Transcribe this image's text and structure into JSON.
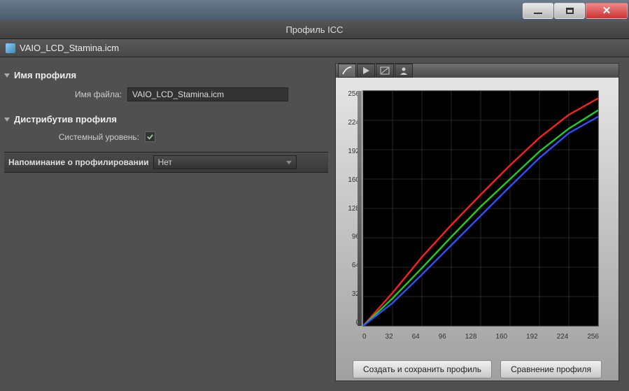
{
  "window": {
    "title": "Профиль ICC",
    "filename": "VAIO_LCD_Stamina.icm"
  },
  "sections": {
    "profile_name": {
      "title": "Имя профиля",
      "filename_label": "Имя файла:",
      "filename_value": "VAIO_LCD_Stamina.icm"
    },
    "distribution": {
      "title": "Дистрибутив профиля",
      "system_level_label": "Системный уровень:",
      "system_level_checked": true
    },
    "reminder": {
      "label": "Напоминание о профилировании",
      "value": "Нет"
    }
  },
  "buttons": {
    "create_save": "Создать и сохранить профиль",
    "compare": "Сравнение профиля"
  },
  "chart_data": {
    "type": "line",
    "xlabel": "",
    "ylabel": "",
    "xlim": [
      0,
      256
    ],
    "ylim": [
      0,
      256
    ],
    "x_ticks": [
      0,
      32,
      64,
      96,
      128,
      160,
      192,
      224,
      256
    ],
    "y_ticks": [
      0,
      32,
      64,
      96,
      128,
      160,
      192,
      224,
      256
    ],
    "series": [
      {
        "name": "red",
        "color": "#ff2020",
        "x": [
          0,
          32,
          64,
          96,
          128,
          160,
          192,
          224,
          256
        ],
        "y": [
          0,
          36,
          75,
          110,
          143,
          175,
          205,
          230,
          248
        ]
      },
      {
        "name": "green",
        "color": "#20d020",
        "x": [
          0,
          32,
          64,
          96,
          128,
          160,
          192,
          224,
          256
        ],
        "y": [
          0,
          30,
          63,
          97,
          130,
          160,
          190,
          215,
          235
        ]
      },
      {
        "name": "blue",
        "color": "#3050ff",
        "x": [
          0,
          32,
          64,
          96,
          128,
          160,
          192,
          224,
          256
        ],
        "y": [
          0,
          25,
          56,
          88,
          120,
          152,
          183,
          210,
          228
        ]
      }
    ]
  }
}
